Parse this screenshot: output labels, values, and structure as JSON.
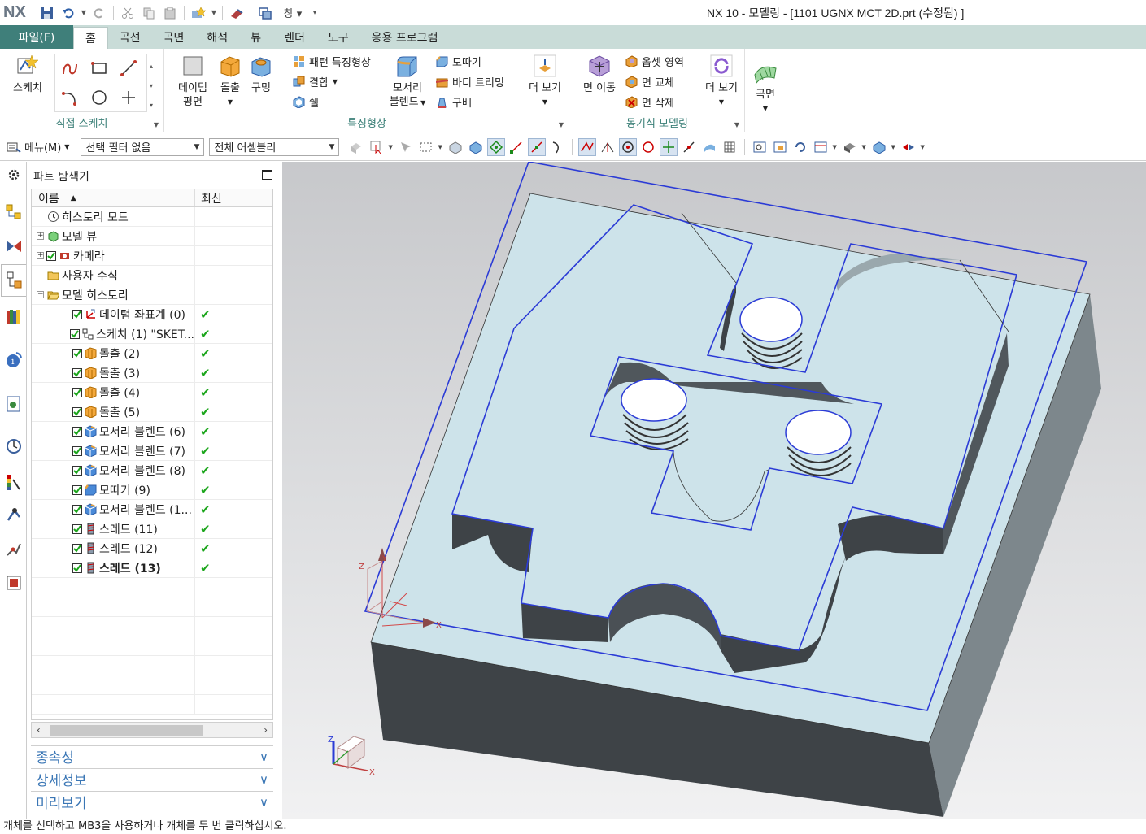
{
  "app": {
    "logo": "NX",
    "window_title": "NX 10 - 모델링 - [1101 UGNX MCT 2D.prt (수정됨) ]"
  },
  "ribbon_tabs": {
    "file": "파일(F)",
    "items": [
      "홈",
      "곡선",
      "곡면",
      "해석",
      "뷰",
      "렌더",
      "도구",
      "응용 프로그램"
    ],
    "active": "홈"
  },
  "ribbon": {
    "sketch_label": "스케치",
    "group_direct_sketch": "직접 스케치",
    "datum_plane_1": "데이텀",
    "datum_plane_2": "평면",
    "extrude": "돌출",
    "hole": "구멍",
    "pattern_feature": "패턴 특징형상",
    "unite": "결합",
    "shell": "쉘",
    "edge_blend_1": "모서리",
    "edge_blend_2": "블렌드",
    "chamfer": "모따기",
    "trim_body": "바디 트리밍",
    "draft": "구배",
    "more": "더 보기",
    "group_feature": "특징형상",
    "move_face": "면 이동",
    "offset_region": "옵셋 영역",
    "replace_face": "면 교체",
    "delete_face": "면 삭제",
    "more2": "더 보기",
    "group_sync": "동기식 모델링",
    "surface": "곡면"
  },
  "toolbar": {
    "menu": "메뉴(M)",
    "selection_filter": "선택 필터 없음",
    "assembly_scope": "전체 어셈블리"
  },
  "navigator": {
    "title": "파트 탐색기",
    "col_name": "이름",
    "col_latest": "최신",
    "rows": [
      {
        "label": "히스토리 모드",
        "icon": "clock-icon",
        "check": false,
        "expand": "",
        "indent": 1,
        "ok": false,
        "bold": false
      },
      {
        "label": "모델 뷰",
        "icon": "model-view-icon",
        "check": false,
        "expand": "+",
        "indent": 1,
        "ok": false,
        "bold": false
      },
      {
        "label": "카메라",
        "icon": "camera-icon",
        "check": true,
        "expand": "+",
        "indent": 1,
        "ok": false,
        "bold": false
      },
      {
        "label": "사용자 수식",
        "icon": "folder-icon",
        "check": false,
        "expand": "",
        "indent": 1,
        "ok": false,
        "bold": false
      },
      {
        "label": "모델 히스토리",
        "icon": "folder-open-icon",
        "check": false,
        "expand": "−",
        "indent": 1,
        "ok": false,
        "bold": false
      },
      {
        "label": "데이텀 좌표계 (0)",
        "icon": "datum-csys-icon",
        "check": true,
        "expand": "",
        "indent": 2,
        "ok": true,
        "bold": false
      },
      {
        "label": "스케치 (1) \"SKET...",
        "icon": "sketch-icon",
        "check": true,
        "expand": "",
        "indent": 2,
        "ok": true,
        "bold": false
      },
      {
        "label": "돌출 (2)",
        "icon": "extrude-icon",
        "check": true,
        "expand": "",
        "indent": 2,
        "ok": true,
        "bold": false
      },
      {
        "label": "돌출 (3)",
        "icon": "extrude-icon",
        "check": true,
        "expand": "",
        "indent": 2,
        "ok": true,
        "bold": false
      },
      {
        "label": "돌출 (4)",
        "icon": "extrude-icon",
        "check": true,
        "expand": "",
        "indent": 2,
        "ok": true,
        "bold": false
      },
      {
        "label": "돌출 (5)",
        "icon": "extrude-icon",
        "check": true,
        "expand": "",
        "indent": 2,
        "ok": true,
        "bold": false
      },
      {
        "label": "모서리 블렌드 (6)",
        "icon": "edge-blend-icon",
        "check": true,
        "expand": "",
        "indent": 2,
        "ok": true,
        "bold": false
      },
      {
        "label": "모서리 블렌드 (7)",
        "icon": "edge-blend-icon",
        "check": true,
        "expand": "",
        "indent": 2,
        "ok": true,
        "bold": false
      },
      {
        "label": "모서리 블렌드 (8)",
        "icon": "edge-blend-icon",
        "check": true,
        "expand": "",
        "indent": 2,
        "ok": true,
        "bold": false
      },
      {
        "label": "모따기 (9)",
        "icon": "chamfer-icon",
        "check": true,
        "expand": "",
        "indent": 2,
        "ok": true,
        "bold": false
      },
      {
        "label": "모서리 블렌드 (1...",
        "icon": "edge-blend-icon",
        "check": true,
        "expand": "",
        "indent": 2,
        "ok": true,
        "bold": false
      },
      {
        "label": "스레드 (11)",
        "icon": "thread-icon",
        "check": true,
        "expand": "",
        "indent": 2,
        "ok": true,
        "bold": false
      },
      {
        "label": "스레드 (12)",
        "icon": "thread-icon",
        "check": true,
        "expand": "",
        "indent": 2,
        "ok": true,
        "bold": false
      },
      {
        "label": "스레드 (13)",
        "icon": "thread-icon",
        "check": true,
        "expand": "",
        "indent": 2,
        "ok": true,
        "bold": true
      }
    ],
    "panels": [
      "종속성",
      "상세정보",
      "미리보기"
    ]
  },
  "status": "개체를 선택하고 MB3을 사용하거나 개체를 두 번 클릭하십시오.",
  "colors": {
    "accent": "#3f7f7a",
    "tab_bar": "#c9dcd8",
    "face_top": "#cde3ea",
    "edge_highlight": "#2b3bd6",
    "side_dark": "#3e4347",
    "ok_green": "#1aa51a"
  }
}
